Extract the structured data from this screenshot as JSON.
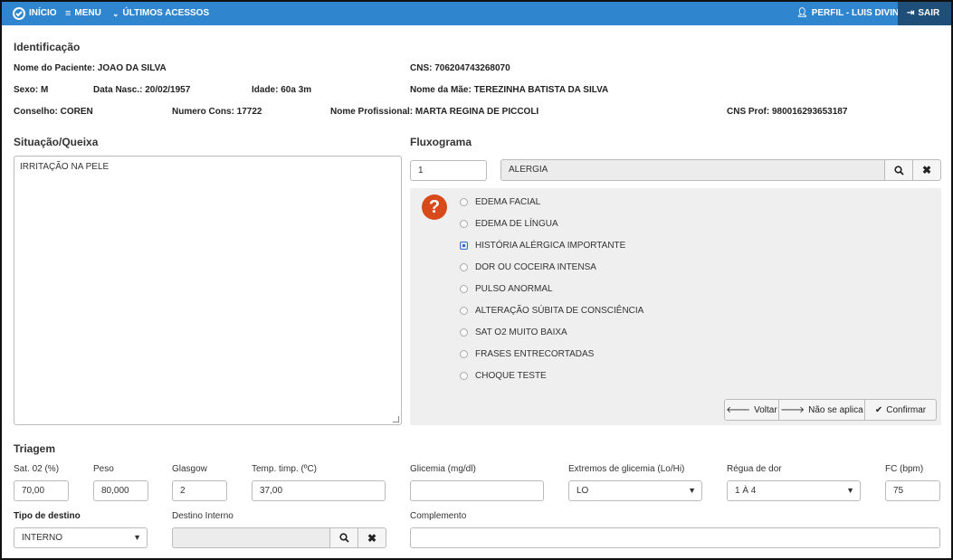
{
  "nav": {
    "inicio": "INÍCIO",
    "menu": "MENU",
    "ultimos": "ÚLTIMOS ACESSOS",
    "perfil": "PERFIL - LUIS DIVINO",
    "sair": "SAIR"
  },
  "identificacao": {
    "title": "Identificação",
    "paciente": "Nome do Paciente: JOAO DA SILVA",
    "cns": "CNS: 706204743268070",
    "sexo": "Sexo: M",
    "nasc": "Data Nasc.: 20/02/1957",
    "idade": "Idade: 60a 3m",
    "mae": "Nome da Mãe: TEREZINHA BATISTA DA SILVA",
    "conselho": "Conselho: COREN",
    "numero": "Numero Cons: 17722",
    "profissional": "Nome Profissional: MARTA REGINA DE PICCOLI",
    "cnsprof": "CNS Prof: 980016293653187"
  },
  "queixa": {
    "title": "Situação/Queixa",
    "text": "IRRITAÇÃO NA PELE"
  },
  "fluxograma": {
    "title": "Fluxograma",
    "code": "1",
    "name": "ALERGIA",
    "options": [
      {
        "label": "EDEMA FACIAL",
        "selected": false
      },
      {
        "label": "EDEMA DE LÍNGUA",
        "selected": false
      },
      {
        "label": "HISTÓRIA ALÉRGICA IMPORTANTE",
        "selected": true
      },
      {
        "label": "DOR OU COCEIRA INTENSA",
        "selected": false
      },
      {
        "label": "PULSO ANORMAL",
        "selected": false
      },
      {
        "label": "ALTERAÇÃO SÚBITA DE CONSCIÊNCIA",
        "selected": false
      },
      {
        "label": "SAT O2 MUITO BAIXA",
        "selected": false
      },
      {
        "label": "FRASES ENTRECORTADAS",
        "selected": false
      },
      {
        "label": "CHOQUE TESTE",
        "selected": false
      }
    ],
    "btn_voltar": "Voltar",
    "btn_nao": "Não se aplica",
    "btn_confirmar": "Confirmar"
  },
  "triagem": {
    "title": "Triagem",
    "sat_label": "Sat. 02 (%)",
    "sat": "70,00",
    "peso_label": "Peso",
    "peso": "80,000",
    "glasgow_label": "Glasgow",
    "glasgow": "2",
    "temp_label": "Temp. timp. (ºC)",
    "temp": "37,00",
    "glic_label": "Glicemia (mg/dl)",
    "glic": "",
    "ext_label": "Extremos de glicemia (Lo/Hi)",
    "ext": "LO",
    "dor_label": "Régua de dor",
    "dor": "1 À 4",
    "fc_label": "FC (bpm)",
    "fc": "75",
    "destino_label": "Tipo de destino",
    "destino": "INTERNO",
    "dint_label": "Destino Interno",
    "dint": "",
    "comp_label": "Complemento",
    "comp": ""
  },
  "icons": {
    "search": "search-icon",
    "clear": "times-icon",
    "caret": "caret-down-icon"
  }
}
